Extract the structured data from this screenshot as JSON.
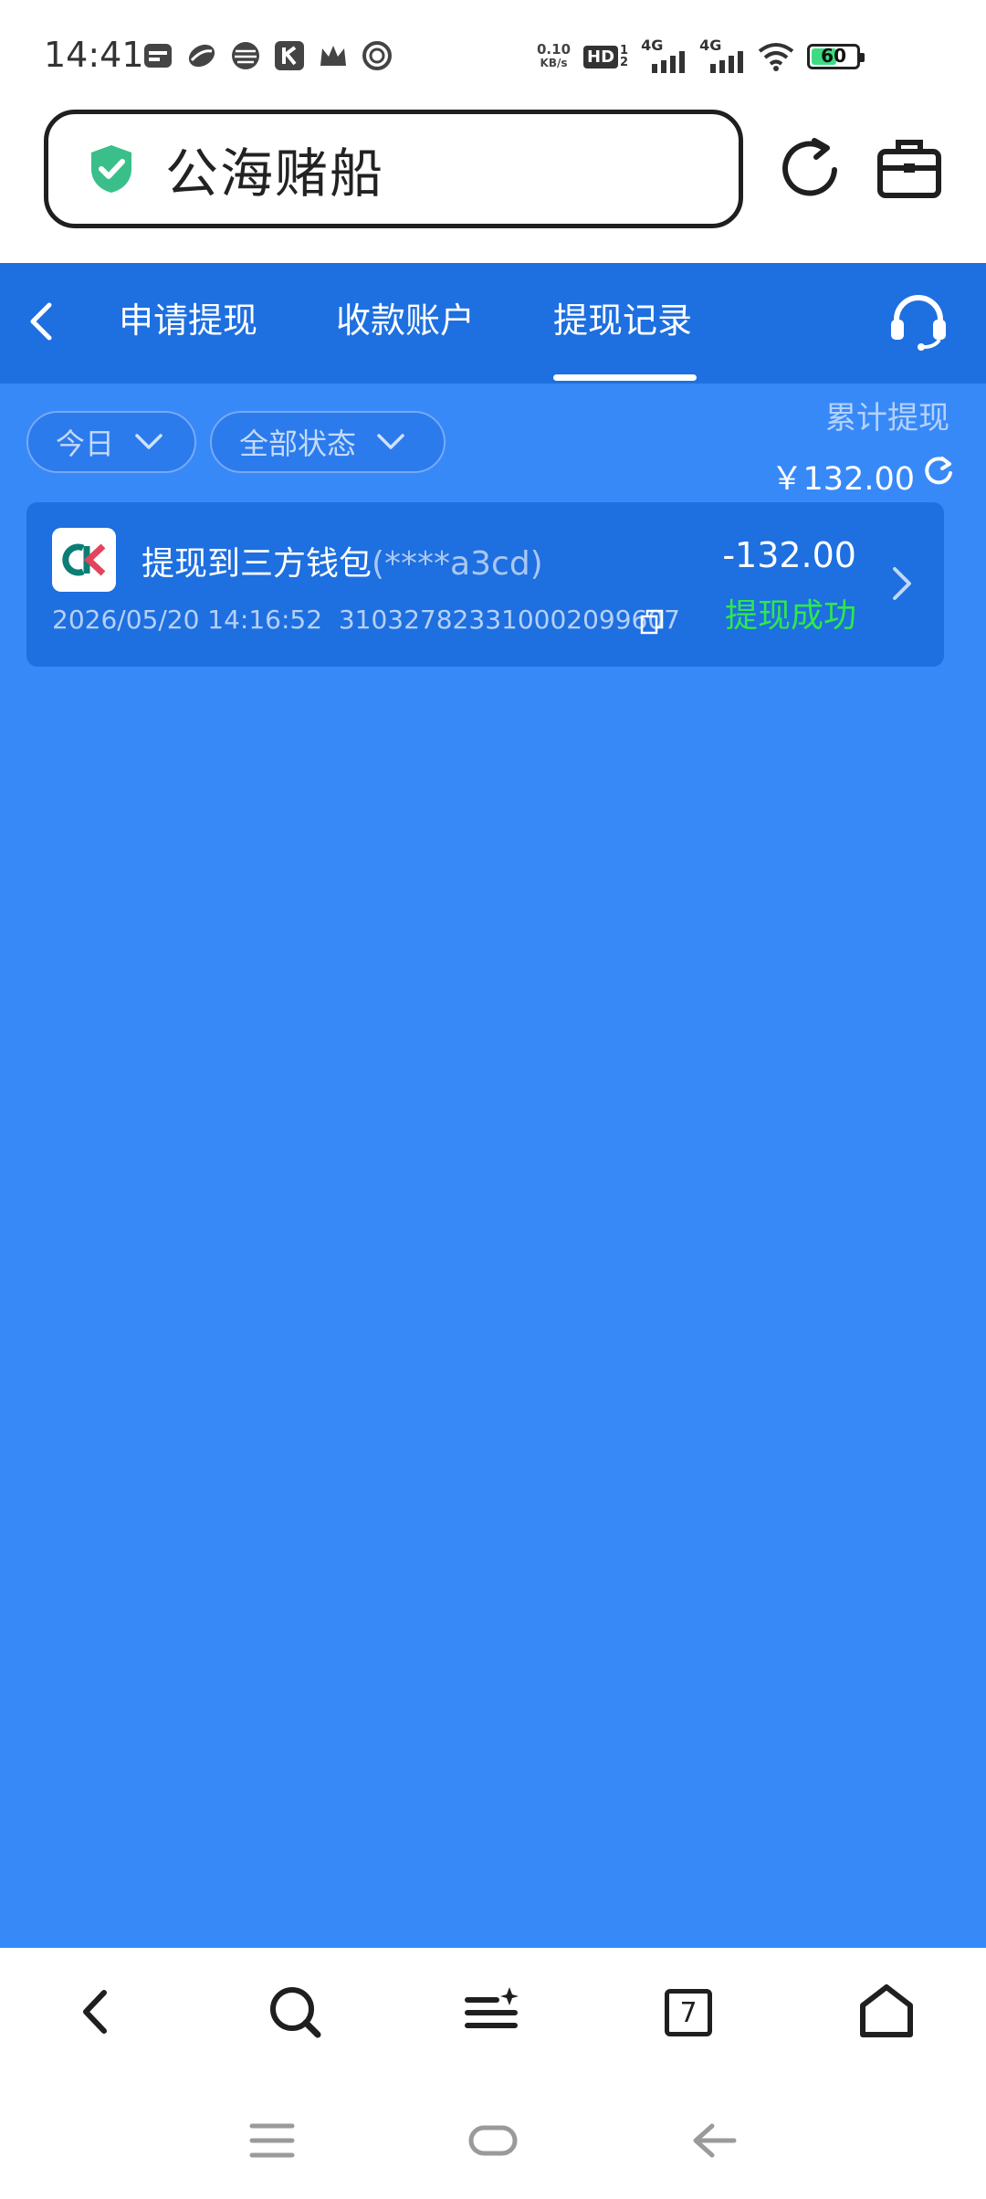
{
  "status_bar": {
    "time": "14:41",
    "net_speed_value": "0.10",
    "net_speed_unit": "KB/s",
    "hd_label": "HD",
    "sim1_label": "4G",
    "sim2_label": "4G",
    "battery_level": "60",
    "battery_fill_fraction": 0.6
  },
  "browser": {
    "url_text": "公海赌船"
  },
  "tabs": [
    {
      "label": "申请提现"
    },
    {
      "label": "收款账户"
    },
    {
      "label": "提现记录",
      "active": true
    }
  ],
  "filters": {
    "date": "今日",
    "status": "全部状态"
  },
  "summary": {
    "label": "累计提现",
    "amount": "￥132.00"
  },
  "records": [
    {
      "title": "提现到三方钱包",
      "account_masked": "(****a3cd)",
      "datetime": "2026/05/20 14:16:52",
      "order_no": "310327823310002099607",
      "amount": "-132.00",
      "status": "提现成功"
    }
  ],
  "bottom_toolbar": {
    "tab_count": "7"
  },
  "colors": {
    "app_background": "#3889f8",
    "tabbar_background": "#1e6fe0",
    "status_success": "#2ee84a"
  }
}
